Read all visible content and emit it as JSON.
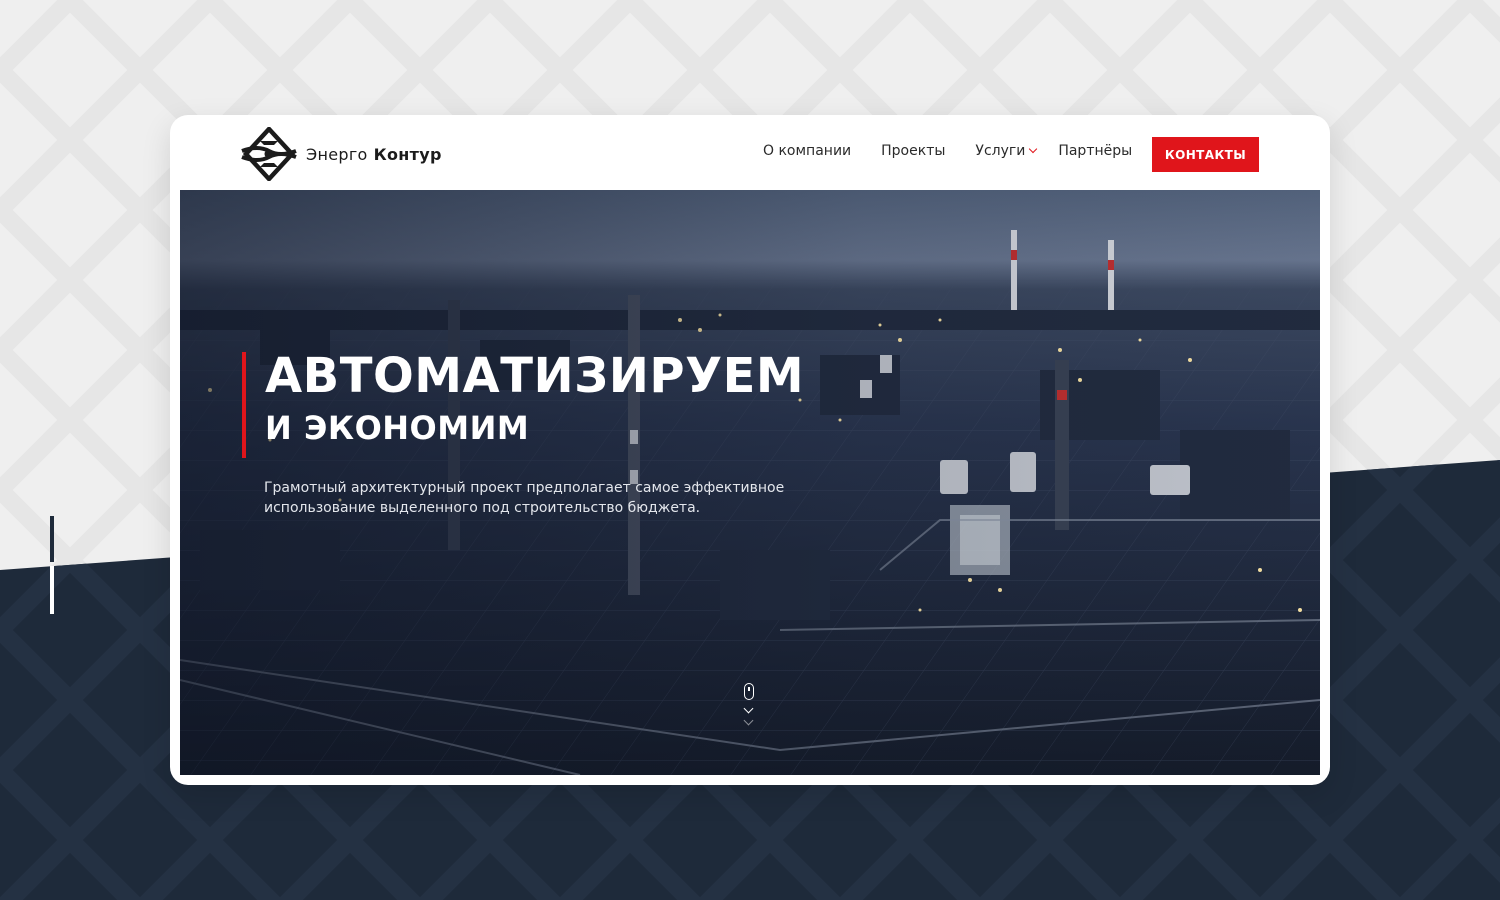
{
  "brand": {
    "name_light": "Энерго",
    "name_bold": "Контур",
    "logo_icon": "energo-kontur-logo-icon"
  },
  "nav": {
    "items": [
      {
        "label": "О компании"
      },
      {
        "label": "Проекты"
      },
      {
        "label": "Услуги",
        "has_dropdown": true
      },
      {
        "label": "Партнёры"
      }
    ],
    "dropdown_icon": "chevron-down-icon"
  },
  "contact_button": {
    "label": "КОНТАКТЫ"
  },
  "hero": {
    "title_line1": "АВТОМАТИЗИРУЕМ",
    "title_line2": "И ЭКОНОМИМ",
    "description": "Грамотный архитектурный проект предполагает самое эффективное использование выделенного под строительство бюджета.",
    "background": "industrial-plant-night-photo",
    "scroll_icon": "mouse-scroll-icon"
  },
  "colors": {
    "accent": "#e0151b",
    "dark_navy": "#1e2a3a",
    "page_bg": "#efefef",
    "hero_overlay": "#1b2436"
  }
}
